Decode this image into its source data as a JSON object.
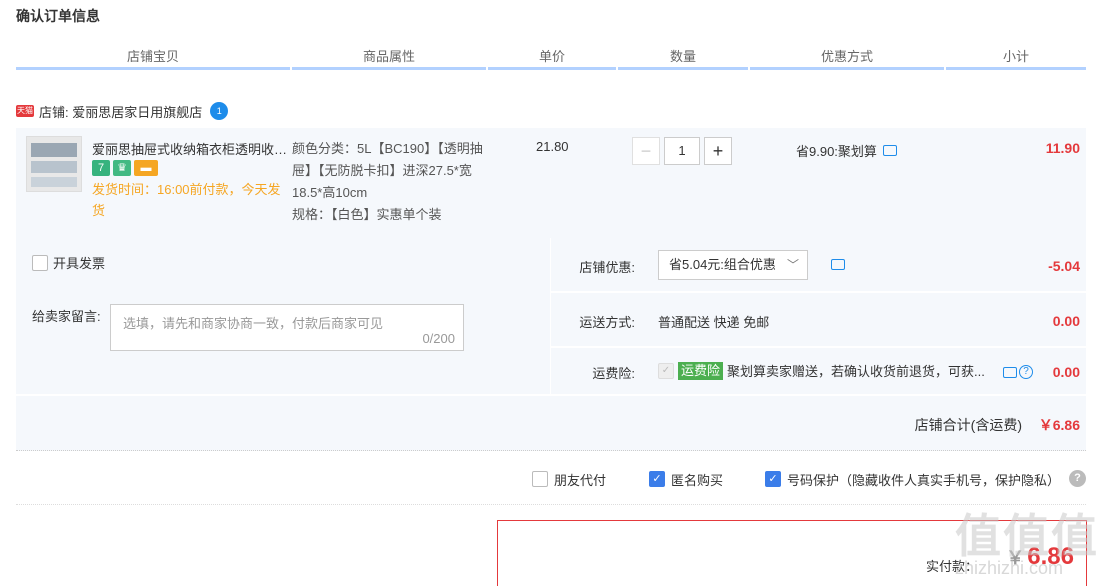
{
  "page": {
    "title": "确认订单信息"
  },
  "columns": [
    "店铺宝贝",
    "商品属性",
    "单价",
    "数量",
    "优惠方式",
    "小计"
  ],
  "shop": {
    "badge": "天猫",
    "label": "店铺: 爱丽思居家日用旗舰店"
  },
  "item": {
    "title": "爱丽思抽屉式收纳箱衣柜透明收纳箱",
    "badges": [
      "7",
      "",
      ""
    ],
    "ship_time": "发货时间：16:00前付款，今天发货",
    "attrs": "颜色分类：5L【BC190】【透明抽屉】【无防脱卡扣】进深27.5*宽18.5*高10cm",
    "spec": "规格：【白色】实惠单个装",
    "price": "21.80",
    "qty": "1",
    "promo": "省9.90:聚划算",
    "subtotal": "11.90"
  },
  "options": {
    "invoice_label": "开具发票",
    "message_label": "给卖家留言:",
    "message_placeholder": "选填，请先和商家协商一致，付款后商家可见",
    "message_count": "0/200",
    "shop_discount_label": "店铺优惠:",
    "shop_discount_value": "省5.04元:组合优惠",
    "shop_discount_amount": "-5.04",
    "shipping_label": "运送方式:",
    "shipping_value": "普通配送 快递 免邮",
    "shipping_amount": "0.00",
    "insurance_label": "运费险:",
    "insurance_badge": "运费险",
    "insurance_text": "聚划算卖家赠送，若确认收货前退货，可获...",
    "insurance_amount": "0.00"
  },
  "shop_total": {
    "label": "店铺合计(含运费)",
    "value": "￥6.86"
  },
  "privacy": {
    "friend_pay": "朋友代付",
    "anonymous": "匿名购买",
    "number_protect": "号码保护（隐藏收件人真实手机号，保护隐私）",
    "help": "?"
  },
  "payment": {
    "label": "实付款：",
    "currency": "￥",
    "amount": "6.86"
  },
  "watermark": {
    "glyphs": "值值值",
    "sub": "zhizhizhi.com"
  },
  "colors": {
    "accent_red": "#e4393c",
    "header_line": "#b2d1ff",
    "blue": "#3b7de9",
    "row_bg": "#f5f8fc"
  }
}
